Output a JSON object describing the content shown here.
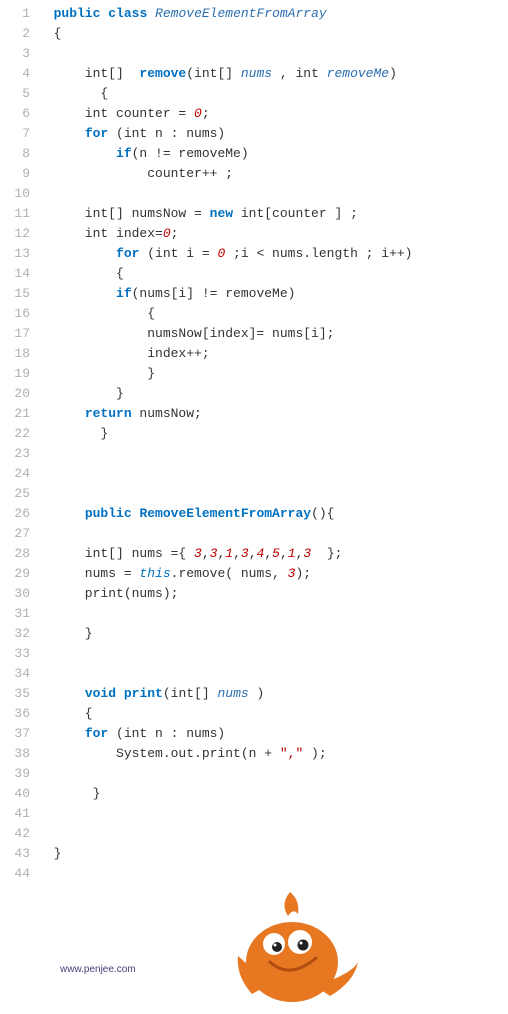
{
  "gutter": [
    "1",
    "2",
    "3",
    "4",
    "5",
    "6",
    "7",
    "8",
    "9",
    "10",
    "11",
    "12",
    "13",
    "14",
    "15",
    "16",
    "17",
    "18",
    "19",
    "20",
    "21",
    "22",
    "23",
    "24",
    "25",
    "26",
    "27",
    "28",
    "29",
    "30",
    "31",
    "32",
    "33",
    "34",
    "35",
    "36",
    "37",
    "38",
    "39",
    "40",
    "41",
    "42",
    "43",
    "44"
  ],
  "tokens": [
    [
      [
        "kw",
        "  public"
      ],
      [
        "pln",
        " "
      ],
      [
        "kw",
        "class"
      ],
      [
        "pln",
        " "
      ],
      [
        "cls",
        "RemoveElementFromArray"
      ]
    ],
    [
      [
        "pln",
        "  {"
      ]
    ],
    [],
    [
      [
        "pln",
        "      int[]  "
      ],
      [
        "fn",
        "remove"
      ],
      [
        "pln",
        "(int[] "
      ],
      [
        "param",
        "nums"
      ],
      [
        "pln",
        " , int "
      ],
      [
        "param",
        "removeMe"
      ],
      [
        "pln",
        ")"
      ]
    ],
    [
      [
        "pln",
        "        {"
      ]
    ],
    [
      [
        "pln",
        "      int counter = "
      ],
      [
        "num",
        "0"
      ],
      [
        "pln",
        ";"
      ]
    ],
    [
      [
        "pln",
        "      "
      ],
      [
        "kw",
        "for"
      ],
      [
        "pln",
        " (int n : nums)"
      ]
    ],
    [
      [
        "pln",
        "          "
      ],
      [
        "kw",
        "if"
      ],
      [
        "pln",
        "(n != removeMe)"
      ]
    ],
    [
      [
        "pln",
        "              counter++ ;"
      ]
    ],
    [],
    [
      [
        "pln",
        "      int[] numsNow = "
      ],
      [
        "kw",
        "new"
      ],
      [
        "pln",
        " int[counter ] ;"
      ]
    ],
    [
      [
        "pln",
        "      int index="
      ],
      [
        "num",
        "0"
      ],
      [
        "pln",
        ";"
      ]
    ],
    [
      [
        "pln",
        "          "
      ],
      [
        "kw",
        "for"
      ],
      [
        "pln",
        " (int i = "
      ],
      [
        "num",
        "0"
      ],
      [
        "pln",
        " ;i < nums.length ; i++)"
      ]
    ],
    [
      [
        "pln",
        "          {"
      ]
    ],
    [
      [
        "pln",
        "          "
      ],
      [
        "kw",
        "if"
      ],
      [
        "pln",
        "(nums[i] != removeMe)"
      ]
    ],
    [
      [
        "pln",
        "              {"
      ]
    ],
    [
      [
        "pln",
        "              numsNow[index]= nums[i];"
      ]
    ],
    [
      [
        "pln",
        "              index++;"
      ]
    ],
    [
      [
        "pln",
        "              }"
      ]
    ],
    [
      [
        "pln",
        "          }"
      ]
    ],
    [
      [
        "pln",
        "      "
      ],
      [
        "kw",
        "return"
      ],
      [
        "pln",
        " numsNow;"
      ]
    ],
    [
      [
        "pln",
        "        }"
      ]
    ],
    [],
    [],
    [],
    [
      [
        "pln",
        "      "
      ],
      [
        "kw",
        "public"
      ],
      [
        "pln",
        " "
      ],
      [
        "fn",
        "RemoveElementFromArray"
      ],
      [
        "pln",
        "(){"
      ]
    ],
    [],
    [
      [
        "pln",
        "      int[] nums ={ "
      ],
      [
        "num",
        "3"
      ],
      [
        "pln",
        ","
      ],
      [
        "num",
        "3"
      ],
      [
        "pln",
        ","
      ],
      [
        "num",
        "1"
      ],
      [
        "pln",
        ","
      ],
      [
        "num",
        "3"
      ],
      [
        "pln",
        ","
      ],
      [
        "num",
        "4"
      ],
      [
        "pln",
        ","
      ],
      [
        "num",
        "5"
      ],
      [
        "pln",
        ","
      ],
      [
        "num",
        "1"
      ],
      [
        "pln",
        ","
      ],
      [
        "num",
        "3"
      ],
      [
        "pln",
        "  };"
      ]
    ],
    [
      [
        "pln",
        "      nums = "
      ],
      [
        "member",
        "this"
      ],
      [
        "pln",
        ".remove( nums, "
      ],
      [
        "num",
        "3"
      ],
      [
        "pln",
        ");"
      ]
    ],
    [
      [
        "pln",
        "      print(nums);"
      ]
    ],
    [],
    [
      [
        "pln",
        "      }"
      ]
    ],
    [],
    [],
    [
      [
        "pln",
        "      "
      ],
      [
        "kw",
        "void"
      ],
      [
        "pln",
        " "
      ],
      [
        "fn",
        "print"
      ],
      [
        "pln",
        "(int[] "
      ],
      [
        "param",
        "nums"
      ],
      [
        "pln",
        " )"
      ]
    ],
    [
      [
        "pln",
        "      {"
      ]
    ],
    [
      [
        "pln",
        "      "
      ],
      [
        "kw",
        "for"
      ],
      [
        "pln",
        " (int n : nums)"
      ]
    ],
    [
      [
        "pln",
        "          System.out.print(n + "
      ],
      [
        "str",
        "\",\""
      ],
      [
        "pln",
        " );"
      ]
    ],
    [],
    [
      [
        "pln",
        "       }"
      ]
    ],
    [],
    [],
    [
      [
        "pln",
        "  }"
      ]
    ],
    []
  ],
  "site": "www.penjee.com"
}
